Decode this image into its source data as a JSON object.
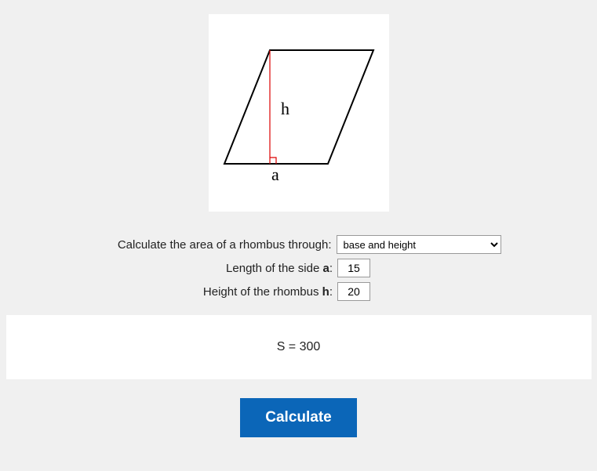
{
  "diagram": {
    "label_h": "h",
    "label_a": "a"
  },
  "form": {
    "method_label": "Calculate the area of a rhombus through:",
    "method_selected": "base and height",
    "side_label_prefix": "Length of the side ",
    "side_label_var": "a",
    "side_label_suffix": ":",
    "side_value": "15",
    "height_label_prefix": "Height of the rhombus ",
    "height_label_var": "h",
    "height_label_suffix": ":",
    "height_value": "20"
  },
  "result": {
    "text": "S = 300"
  },
  "button": {
    "calculate": "Calculate"
  }
}
